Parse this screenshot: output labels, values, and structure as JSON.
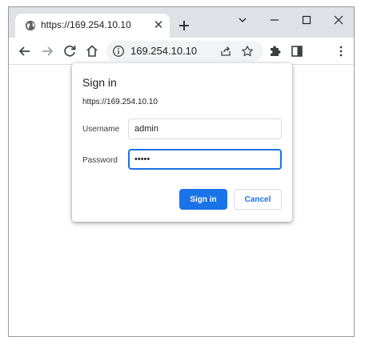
{
  "tab": {
    "title": "https://169.254.10.10"
  },
  "omnibox": {
    "url": "169.254.10.10"
  },
  "dialog": {
    "title": "Sign in",
    "origin": "https://169.254.10.10",
    "username_label": "Username",
    "username_value": "admin",
    "password_label": "Password",
    "password_value": "admin",
    "sign_in_label": "Sign in",
    "cancel_label": "Cancel"
  },
  "colors": {
    "accent": "#1a73e8",
    "tabstrip": "#dee1e6",
    "omnibox": "#f1f3f4"
  },
  "icons": {
    "tab": "globe-icon",
    "tab_close": "close-icon",
    "new_tab": "plus-icon",
    "window_controls": [
      "chevron-down-icon",
      "minimize-icon",
      "maximize-icon",
      "close-icon"
    ],
    "toolbar": [
      "back-arrow-icon",
      "forward-arrow-icon",
      "reload-icon",
      "home-icon"
    ],
    "omnibox": [
      "info-icon",
      "share-icon",
      "star-icon"
    ],
    "toolbar_right": [
      "puzzle-icon",
      "side-panel-icon",
      "kebab-menu-icon"
    ]
  }
}
